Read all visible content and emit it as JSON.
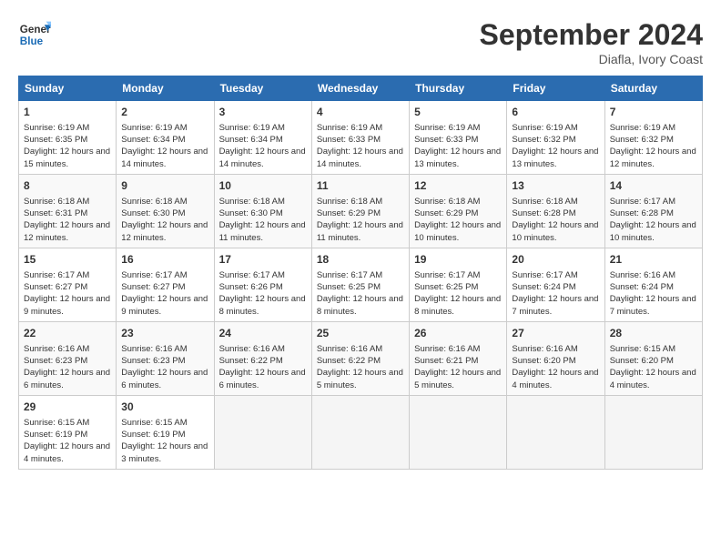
{
  "logo": {
    "line1": "General",
    "line2": "Blue"
  },
  "title": "September 2024",
  "location": "Diafla, Ivory Coast",
  "days_of_week": [
    "Sunday",
    "Monday",
    "Tuesday",
    "Wednesday",
    "Thursday",
    "Friday",
    "Saturday"
  ],
  "weeks": [
    [
      {
        "num": "1",
        "data": "Sunrise: 6:19 AM\nSunset: 6:35 PM\nDaylight: 12 hours and 15 minutes."
      },
      {
        "num": "2",
        "data": "Sunrise: 6:19 AM\nSunset: 6:34 PM\nDaylight: 12 hours and 14 minutes."
      },
      {
        "num": "3",
        "data": "Sunrise: 6:19 AM\nSunset: 6:34 PM\nDaylight: 12 hours and 14 minutes."
      },
      {
        "num": "4",
        "data": "Sunrise: 6:19 AM\nSunset: 6:33 PM\nDaylight: 12 hours and 14 minutes."
      },
      {
        "num": "5",
        "data": "Sunrise: 6:19 AM\nSunset: 6:33 PM\nDaylight: 12 hours and 13 minutes."
      },
      {
        "num": "6",
        "data": "Sunrise: 6:19 AM\nSunset: 6:32 PM\nDaylight: 12 hours and 13 minutes."
      },
      {
        "num": "7",
        "data": "Sunrise: 6:19 AM\nSunset: 6:32 PM\nDaylight: 12 hours and 12 minutes."
      }
    ],
    [
      {
        "num": "8",
        "data": "Sunrise: 6:18 AM\nSunset: 6:31 PM\nDaylight: 12 hours and 12 minutes."
      },
      {
        "num": "9",
        "data": "Sunrise: 6:18 AM\nSunset: 6:30 PM\nDaylight: 12 hours and 12 minutes."
      },
      {
        "num": "10",
        "data": "Sunrise: 6:18 AM\nSunset: 6:30 PM\nDaylight: 12 hours and 11 minutes."
      },
      {
        "num": "11",
        "data": "Sunrise: 6:18 AM\nSunset: 6:29 PM\nDaylight: 12 hours and 11 minutes."
      },
      {
        "num": "12",
        "data": "Sunrise: 6:18 AM\nSunset: 6:29 PM\nDaylight: 12 hours and 10 minutes."
      },
      {
        "num": "13",
        "data": "Sunrise: 6:18 AM\nSunset: 6:28 PM\nDaylight: 12 hours and 10 minutes."
      },
      {
        "num": "14",
        "data": "Sunrise: 6:17 AM\nSunset: 6:28 PM\nDaylight: 12 hours and 10 minutes."
      }
    ],
    [
      {
        "num": "15",
        "data": "Sunrise: 6:17 AM\nSunset: 6:27 PM\nDaylight: 12 hours and 9 minutes."
      },
      {
        "num": "16",
        "data": "Sunrise: 6:17 AM\nSunset: 6:27 PM\nDaylight: 12 hours and 9 minutes."
      },
      {
        "num": "17",
        "data": "Sunrise: 6:17 AM\nSunset: 6:26 PM\nDaylight: 12 hours and 8 minutes."
      },
      {
        "num": "18",
        "data": "Sunrise: 6:17 AM\nSunset: 6:25 PM\nDaylight: 12 hours and 8 minutes."
      },
      {
        "num": "19",
        "data": "Sunrise: 6:17 AM\nSunset: 6:25 PM\nDaylight: 12 hours and 8 minutes."
      },
      {
        "num": "20",
        "data": "Sunrise: 6:17 AM\nSunset: 6:24 PM\nDaylight: 12 hours and 7 minutes."
      },
      {
        "num": "21",
        "data": "Sunrise: 6:16 AM\nSunset: 6:24 PM\nDaylight: 12 hours and 7 minutes."
      }
    ],
    [
      {
        "num": "22",
        "data": "Sunrise: 6:16 AM\nSunset: 6:23 PM\nDaylight: 12 hours and 6 minutes."
      },
      {
        "num": "23",
        "data": "Sunrise: 6:16 AM\nSunset: 6:23 PM\nDaylight: 12 hours and 6 minutes."
      },
      {
        "num": "24",
        "data": "Sunrise: 6:16 AM\nSunset: 6:22 PM\nDaylight: 12 hours and 6 minutes."
      },
      {
        "num": "25",
        "data": "Sunrise: 6:16 AM\nSunset: 6:22 PM\nDaylight: 12 hours and 5 minutes."
      },
      {
        "num": "26",
        "data": "Sunrise: 6:16 AM\nSunset: 6:21 PM\nDaylight: 12 hours and 5 minutes."
      },
      {
        "num": "27",
        "data": "Sunrise: 6:16 AM\nSunset: 6:20 PM\nDaylight: 12 hours and 4 minutes."
      },
      {
        "num": "28",
        "data": "Sunrise: 6:15 AM\nSunset: 6:20 PM\nDaylight: 12 hours and 4 minutes."
      }
    ],
    [
      {
        "num": "29",
        "data": "Sunrise: 6:15 AM\nSunset: 6:19 PM\nDaylight: 12 hours and 4 minutes."
      },
      {
        "num": "30",
        "data": "Sunrise: 6:15 AM\nSunset: 6:19 PM\nDaylight: 12 hours and 3 minutes."
      },
      null,
      null,
      null,
      null,
      null
    ]
  ]
}
